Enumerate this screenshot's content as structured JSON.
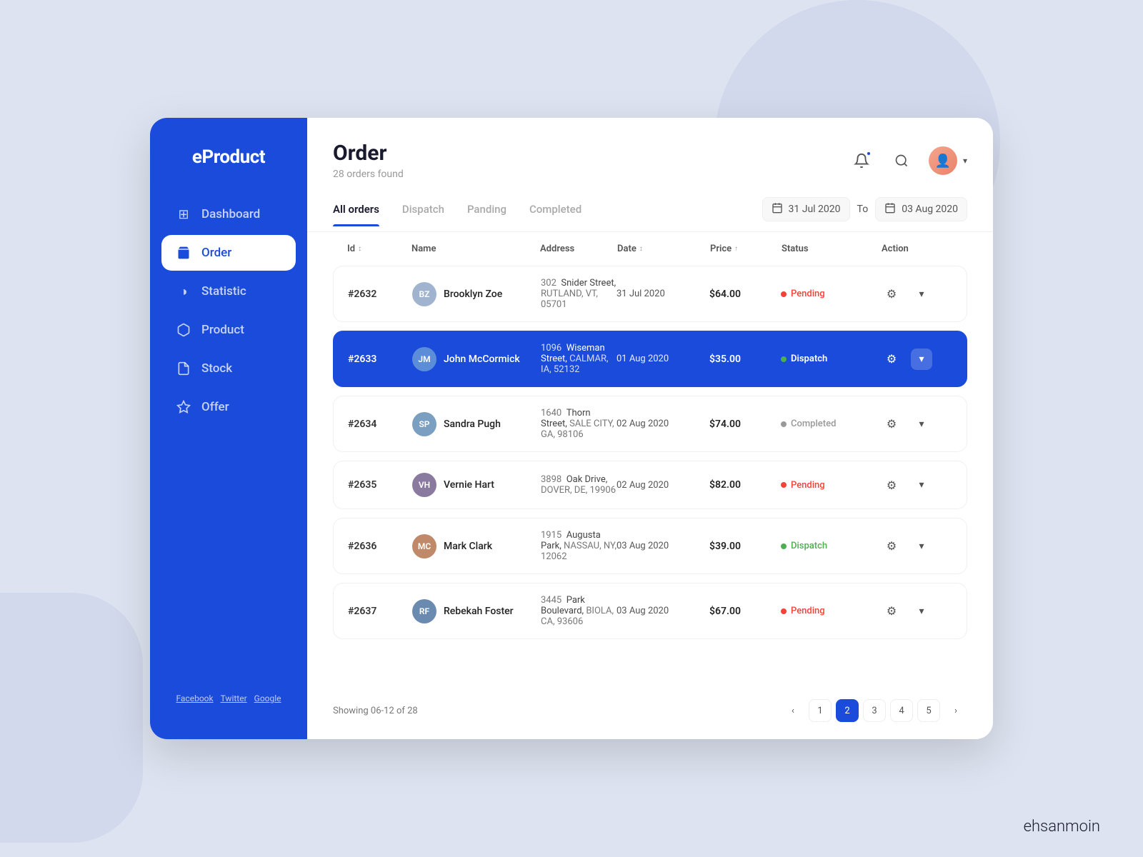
{
  "app": {
    "name": "eProduct",
    "footer_brand_bold": "ehsan",
    "footer_brand_light": "moin"
  },
  "sidebar": {
    "items": [
      {
        "id": "dashboard",
        "label": "Dashboard",
        "icon": "⊞",
        "active": false
      },
      {
        "id": "order",
        "label": "Order",
        "icon": "🛒",
        "active": true
      },
      {
        "id": "statistic",
        "label": "Statistic",
        "icon": "◑",
        "active": false
      },
      {
        "id": "product",
        "label": "Product",
        "icon": "📦",
        "active": false
      },
      {
        "id": "stock",
        "label": "Stock",
        "icon": "📎",
        "active": false
      },
      {
        "id": "offer",
        "label": "Offer",
        "icon": "🏷",
        "active": false
      }
    ],
    "footer_links": [
      "Facebook",
      "Twitter",
      "Google"
    ]
  },
  "header": {
    "title": "Order",
    "subtitle": "28 orders found"
  },
  "tabs": [
    {
      "id": "all-orders",
      "label": "All orders",
      "active": true
    },
    {
      "id": "dispatch",
      "label": "Dispatch",
      "active": false
    },
    {
      "id": "panding",
      "label": "Panding",
      "active": false
    },
    {
      "id": "completed",
      "label": "Completed",
      "active": false
    }
  ],
  "date_filter": {
    "from": "31 Jul 2020",
    "to": "03 Aug 2020",
    "separator": "To"
  },
  "table": {
    "columns": [
      "Id",
      "Name",
      "Address",
      "Date",
      "Price",
      "Status",
      "Action"
    ],
    "rows": [
      {
        "id": "#2632",
        "name": "Brooklyn Zoe",
        "avatar_color": "#a0b4d0",
        "address_num": "302",
        "address_street": "Snider Street,",
        "address_city": "RUTLAND, VT, 05701",
        "date": "31 Jul 2020",
        "price": "$64.00",
        "status": "Pending",
        "status_type": "pending",
        "highlighted": false
      },
      {
        "id": "#2633",
        "name": "John McCormick",
        "avatar_color": "#5b8dd9",
        "address_num": "1096",
        "address_street": "Wiseman Street,",
        "address_city": "CALMAR, IA, 52132",
        "date": "01 Aug 2020",
        "price": "$35.00",
        "status": "Dispatch",
        "status_type": "dispatch",
        "highlighted": true
      },
      {
        "id": "#2634",
        "name": "Sandra Pugh",
        "avatar_color": "#7a9fc0",
        "address_num": "1640",
        "address_street": "Thorn Street,",
        "address_city": "SALE CITY, GA, 98106",
        "date": "02 Aug 2020",
        "price": "$74.00",
        "status": "Completed",
        "status_type": "completed",
        "highlighted": false
      },
      {
        "id": "#2635",
        "name": "Vernie Hart",
        "avatar_color": "#8a7a9f",
        "address_num": "3898",
        "address_street": "Oak Drive,",
        "address_city": "DOVER, DE, 19906",
        "date": "02 Aug 2020",
        "price": "$82.00",
        "status": "Pending",
        "status_type": "pending",
        "highlighted": false
      },
      {
        "id": "#2636",
        "name": "Mark Clark",
        "avatar_color": "#c08a6a",
        "address_num": "1915",
        "address_street": "Augusta Park,",
        "address_city": "NASSAU, NY, 12062",
        "date": "03 Aug 2020",
        "price": "$39.00",
        "status": "Dispatch",
        "status_type": "dispatch",
        "highlighted": false
      },
      {
        "id": "#2637",
        "name": "Rebekah Foster",
        "avatar_color": "#6a8ab0",
        "address_num": "3445",
        "address_street": "Park Boulevard,",
        "address_city": "BIOLA, CA, 93606",
        "date": "03 Aug 2020",
        "price": "$67.00",
        "status": "Pending",
        "status_type": "pending",
        "highlighted": false
      }
    ]
  },
  "pagination": {
    "info": "Showing 06-12 of 28",
    "pages": [
      "1",
      "2",
      "3",
      "4",
      "5"
    ],
    "active_page": "2"
  }
}
